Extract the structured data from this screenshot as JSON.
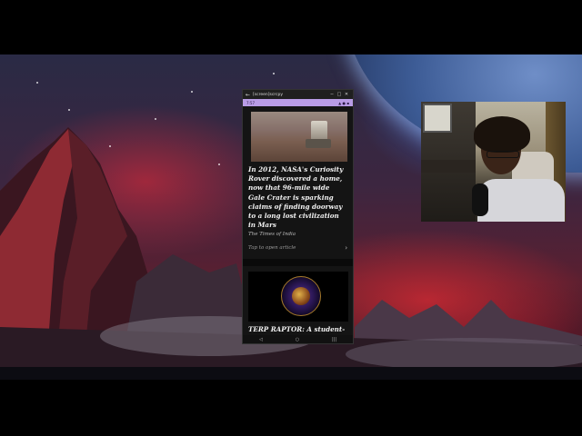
{
  "phone_window": {
    "title": "[screen]scrcpy",
    "controls": [
      "─",
      "□",
      "✕"
    ],
    "status_time": "7:57",
    "status_icons": "▲ ● ▪"
  },
  "articles": [
    {
      "headline": "In 2012, NASA's Curiosity Rover discovered a home, now that 96-mile wide Gale Crater is sparking claims of finding doorway to a long lost civilization in Mars",
      "source": "The Times of India",
      "action": "Tap to open article",
      "action_icon": "chevron-right-icon"
    },
    {
      "headline": "TERP RAPTOR: A student-built mission to asteroid Apophis"
    }
  ],
  "navbar": {
    "back": "◁",
    "home": "○",
    "recents": "|||"
  },
  "colors": {
    "status_bar": "#b99ce6",
    "feed_background": "#141414"
  }
}
